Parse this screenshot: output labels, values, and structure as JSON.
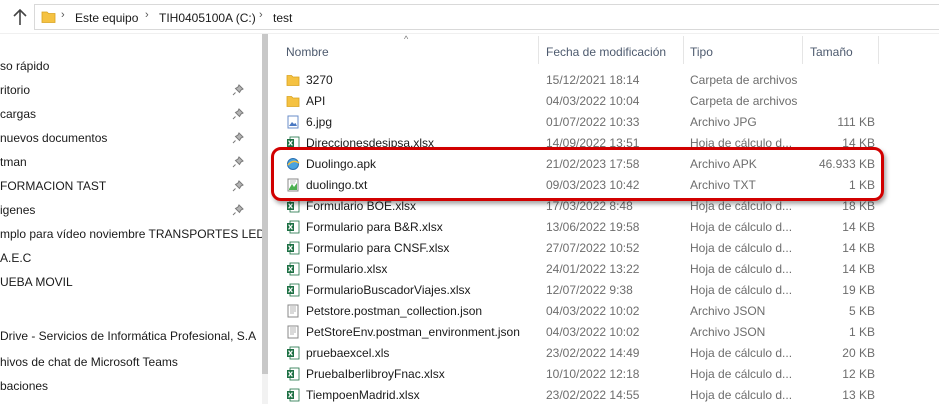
{
  "address": {
    "crumbs": [
      "Este equipo",
      "TIH0405100A (C:)",
      "test"
    ]
  },
  "nav": {
    "items": [
      {
        "label": "so rápido",
        "pinned": false
      },
      {
        "label": "ritorio",
        "pinned": true
      },
      {
        "label": "cargas",
        "pinned": true
      },
      {
        "label": " nuevos documentos",
        "pinned": true
      },
      {
        "label": "tman",
        "pinned": true
      },
      {
        "label": "  FORMACION TAST",
        "pinned": true
      },
      {
        "label": "igenes",
        "pinned": true
      },
      {
        "label": "mplo para vídeo  noviembre TRANSPORTES LED",
        "pinned": false
      },
      {
        "label": "A.E.C",
        "pinned": false
      },
      {
        "label": "UEBA MOVIL",
        "pinned": false
      },
      {
        "label": "",
        "pinned": false
      },
      {
        "label": "Drive - Servicios de Informática Profesional, S.A",
        "pinned": false
      },
      {
        "label": "hivos de chat de Microsoft Teams",
        "pinned": false
      },
      {
        "label": "baciones",
        "pinned": false
      }
    ]
  },
  "columns": {
    "name": "Nombre",
    "date": "Fecha de modificación",
    "type": "Tipo",
    "size": "Tamaño"
  },
  "files": [
    {
      "name": "3270",
      "date": "15/12/2021 18:14",
      "type": "Carpeta de archivos",
      "size": "",
      "icon": "folder-icon"
    },
    {
      "name": "API",
      "date": "04/03/2022 10:04",
      "type": "Carpeta de archivos",
      "size": "",
      "icon": "folder-icon"
    },
    {
      "name": "6.jpg",
      "date": "01/07/2022 10:33",
      "type": "Archivo JPG",
      "size": "111 KB",
      "icon": "image-file-icon"
    },
    {
      "name": "Direccionesdesipsa.xlsx",
      "date": "14/09/2022 13:51",
      "type": "Hoja de cálculo d...",
      "size": "14 KB",
      "icon": "excel-file-icon"
    },
    {
      "name": "Duolingo.apk",
      "date": "21/02/2023 17:58",
      "type": "Archivo APK",
      "size": "46.933 KB",
      "icon": "apk-file-icon"
    },
    {
      "name": "duolingo.txt",
      "date": "09/03/2023 10:42",
      "type": "Archivo TXT",
      "size": "1 KB",
      "icon": "text-file-icon"
    },
    {
      "name": "Formulario BOE.xlsx",
      "date": "17/03/2022 8:48",
      "type": "Hoja de cálculo d...",
      "size": "18 KB",
      "icon": "excel-file-icon"
    },
    {
      "name": "Formulario para B&R.xlsx",
      "date": "13/06/2022 19:58",
      "type": "Hoja de cálculo d...",
      "size": "14 KB",
      "icon": "excel-file-icon"
    },
    {
      "name": "Formulario para CNSF.xlsx",
      "date": "27/07/2022 10:52",
      "type": "Hoja de cálculo d...",
      "size": "14 KB",
      "icon": "excel-file-icon"
    },
    {
      "name": "Formulario.xlsx",
      "date": "24/01/2022 13:22",
      "type": "Hoja de cálculo d...",
      "size": "14 KB",
      "icon": "excel-file-icon"
    },
    {
      "name": "FormularioBuscadorViajes.xlsx",
      "date": "12/07/2022 9:38",
      "type": "Hoja de cálculo d...",
      "size": "19 KB",
      "icon": "excel-file-icon"
    },
    {
      "name": "Petstore.postman_collection.json",
      "date": "04/03/2022 10:02",
      "type": "Archivo JSON",
      "size": "5 KB",
      "icon": "json-file-icon"
    },
    {
      "name": "PetStoreEnv.postman_environment.json",
      "date": "04/03/2022 10:02",
      "type": "Archivo JSON",
      "size": "1 KB",
      "icon": "json-file-icon"
    },
    {
      "name": "pruebaexcel.xls",
      "date": "23/02/2022 14:49",
      "type": "Hoja de cálculo d...",
      "size": "20 KB",
      "icon": "excel-file-icon"
    },
    {
      "name": "PruebaIberlibroyFnac.xlsx",
      "date": "10/10/2022 12:18",
      "type": "Hoja de cálculo d...",
      "size": "12 KB",
      "icon": "excel-file-icon"
    },
    {
      "name": "TiempoenMadrid.xlsx",
      "date": "23/02/2022 14:55",
      "type": "Hoja de cálculo d...",
      "size": "13 KB",
      "icon": "excel-file-icon"
    }
  ],
  "colors": {
    "highlight_box": "#d10000",
    "folder": "#f5c242",
    "excel": "#1d7044"
  }
}
